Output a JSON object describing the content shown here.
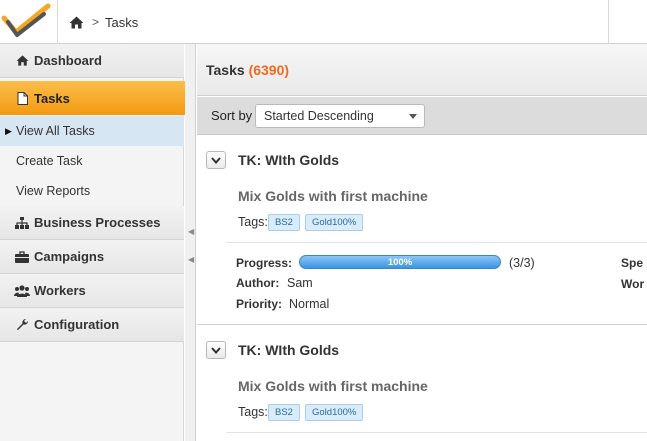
{
  "breadcrumb": {
    "current": "Tasks",
    "separator": ">"
  },
  "sidebar": {
    "items": [
      {
        "label": "Dashboard",
        "icon": "home-icon"
      },
      {
        "label": "Tasks",
        "icon": "document-icon",
        "active": true
      },
      {
        "label": "Business Processes",
        "icon": "sitemap-icon"
      },
      {
        "label": "Campaigns",
        "icon": "briefcase-icon"
      },
      {
        "label": "Workers",
        "icon": "users-icon"
      },
      {
        "label": "Configuration",
        "icon": "wrench-icon"
      }
    ],
    "sub_items": [
      {
        "label": "View All Tasks",
        "current": true
      },
      {
        "label": "Create Task"
      },
      {
        "label": "View Reports"
      }
    ]
  },
  "main": {
    "title": "Tasks",
    "count": "(6390)",
    "sort_label": "Sort by",
    "sort_value": "Started Descending"
  },
  "tasks": [
    {
      "title": "TK: WIth Golds",
      "subtitle": "Mix Golds with first machine",
      "tags_label": "Tags:",
      "tags": [
        "BS2",
        "Gold100%"
      ],
      "progress_label": "Progress:",
      "progress": 1.0,
      "progress_text": "100%",
      "progress_count": "(3/3)",
      "author_label": "Author:",
      "author": "Sam",
      "priority_label": "Priority:",
      "priority": "Normal",
      "right_col_1": "Spe",
      "right_col_2": "Wor"
    },
    {
      "title": "TK: WIth Golds",
      "subtitle": "Mix Golds with first machine",
      "tags_label": "Tags:",
      "tags": [
        "BS2",
        "Gold100%"
      ]
    }
  ],
  "colors": {
    "accent": "#f5a623",
    "count": "#f06a1e",
    "tag_bg": "#d9ecfa",
    "progress": "#3b95e0"
  }
}
